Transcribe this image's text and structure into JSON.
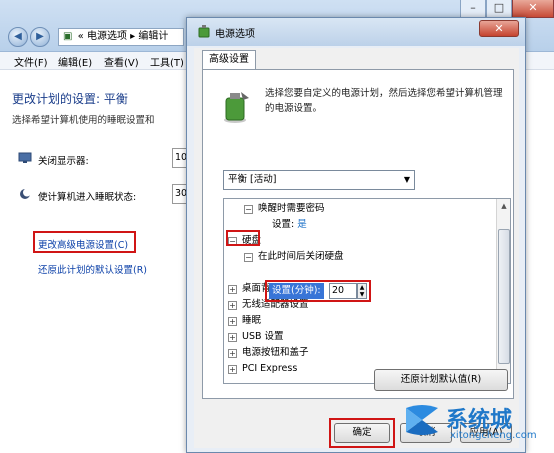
{
  "background_window": {
    "address_prefix": "«",
    "address_path": "电源选项 ▸ 编辑计",
    "menu": [
      "文件(F)",
      "编辑(E)",
      "查看(V)",
      "工具(T)"
    ],
    "title": "更改计划的设置: 平衡",
    "subtitle": "选择希望计算机使用的睡眠设置和",
    "display_off_label": "关闭显示器:",
    "display_off_value": "10",
    "sleep_label": "使计算机进入睡眠状态:",
    "sleep_value": "30",
    "link_advanced": "更改高级电源设置(C)",
    "link_restore": "还原此计划的默认设置(R)"
  },
  "dialog": {
    "title": "电源选项",
    "close_label": "✕",
    "tab_label": "高级设置",
    "description": "选择您要自定义的电源计划，然后选择您希望计算机管理的电源设置。",
    "plan_selected": "平衡 [活动]",
    "tree": [
      {
        "expander": "⊟",
        "label": "唤醒时需要密码",
        "indent": 1
      },
      {
        "label": "设置:",
        "value": "是",
        "indent": 2
      },
      {
        "expander": "⊟",
        "label": "硬盘",
        "indent": 0
      },
      {
        "expander": "⊟",
        "label": "在此时间后关闭硬盘",
        "indent": 1
      },
      {
        "label": "设置(分钟):",
        "value": "20",
        "indent": 2
      },
      {
        "expander": "⊞",
        "label": "桌面背景设置",
        "indent": 0
      },
      {
        "expander": "⊞",
        "label": "无线适配器设置",
        "indent": 0
      },
      {
        "expander": "⊞",
        "label": "睡眠",
        "indent": 0
      },
      {
        "expander": "⊞",
        "label": "USB 设置",
        "indent": 0
      },
      {
        "expander": "⊞",
        "label": "电源按钮和盖子",
        "indent": 0
      },
      {
        "expander": "⊞",
        "label": "PCI Express",
        "indent": 0
      }
    ],
    "restore_button": "还原计划默认值(R)",
    "ok_button": "确定",
    "cancel_button": "取消",
    "apply_button": "应用(A)"
  },
  "watermark": {
    "brand": "系统城",
    "url": "xitongcheng.com"
  },
  "colors": {
    "highlight_red": "#d01515",
    "selection_blue": "#3875d7",
    "link_blue": "#0a3fa8"
  }
}
